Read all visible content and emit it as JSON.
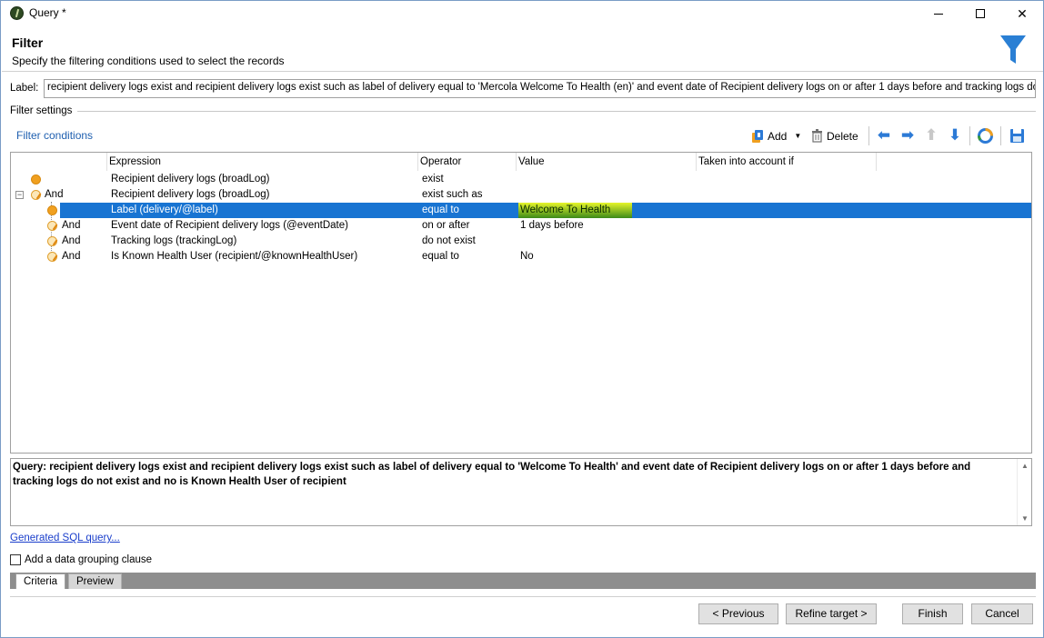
{
  "window": {
    "title": "Query *"
  },
  "header": {
    "title": "Filter",
    "subtitle": "Specify the filtering conditions used to select the records"
  },
  "label_field": {
    "caption": "Label:",
    "value": "recipient delivery logs exist and recipient delivery logs exist such as label of delivery equal to 'Mercola Welcome To Health (en)' and event date of Recipient delivery logs on or after 1 days before and tracking logs do not exist and no is Known Health User of recipient"
  },
  "filter_settings": {
    "caption": "Filter settings",
    "conditions_caption": "Filter conditions",
    "toolbar": {
      "add_label": "Add",
      "delete_label": "Delete"
    }
  },
  "grid": {
    "columns": {
      "expression": "Expression",
      "operator": "Operator",
      "value": "Value",
      "taken": "Taken into account if"
    },
    "rows": [
      {
        "conj": "",
        "expression": "Recipient delivery logs (broadLog)",
        "operator": "exist",
        "value": ""
      },
      {
        "conj": "And",
        "expression": "Recipient delivery logs (broadLog)",
        "operator": "exist such as",
        "value": ""
      },
      {
        "conj": "",
        "expression": "Label (delivery/@label)",
        "operator": "equal to",
        "value": "Welcome To Health"
      },
      {
        "conj": "And",
        "expression": "Event date of Recipient delivery logs (@eventDate)",
        "operator": "on or after",
        "value": "1 days before"
      },
      {
        "conj": "And",
        "expression": "Tracking logs (trackingLog)",
        "operator": "do not exist",
        "value": ""
      },
      {
        "conj": "And",
        "expression": "Is Known Health User (recipient/@knownHealthUser)",
        "operator": "equal to",
        "value": "No"
      }
    ]
  },
  "query": {
    "text": "Query: recipient delivery logs exist and recipient delivery logs exist such as label of delivery equal to 'Welcome To Health' and event date of Recipient delivery logs on or after 1 days before and tracking logs do not exist and no is Known Health User of recipient"
  },
  "links": {
    "sql": "Generated SQL query..."
  },
  "grouping": {
    "label": "Add a data grouping clause",
    "checked": false
  },
  "tabs": {
    "criteria": "Criteria",
    "preview": "Preview"
  },
  "buttons": {
    "previous": "< Previous",
    "refine": "Refine target >",
    "finish": "Finish",
    "cancel": "Cancel"
  },
  "colors": {
    "selection": "#1874d2",
    "link": "#1a3ecb",
    "accent": "#2c7ad6"
  }
}
